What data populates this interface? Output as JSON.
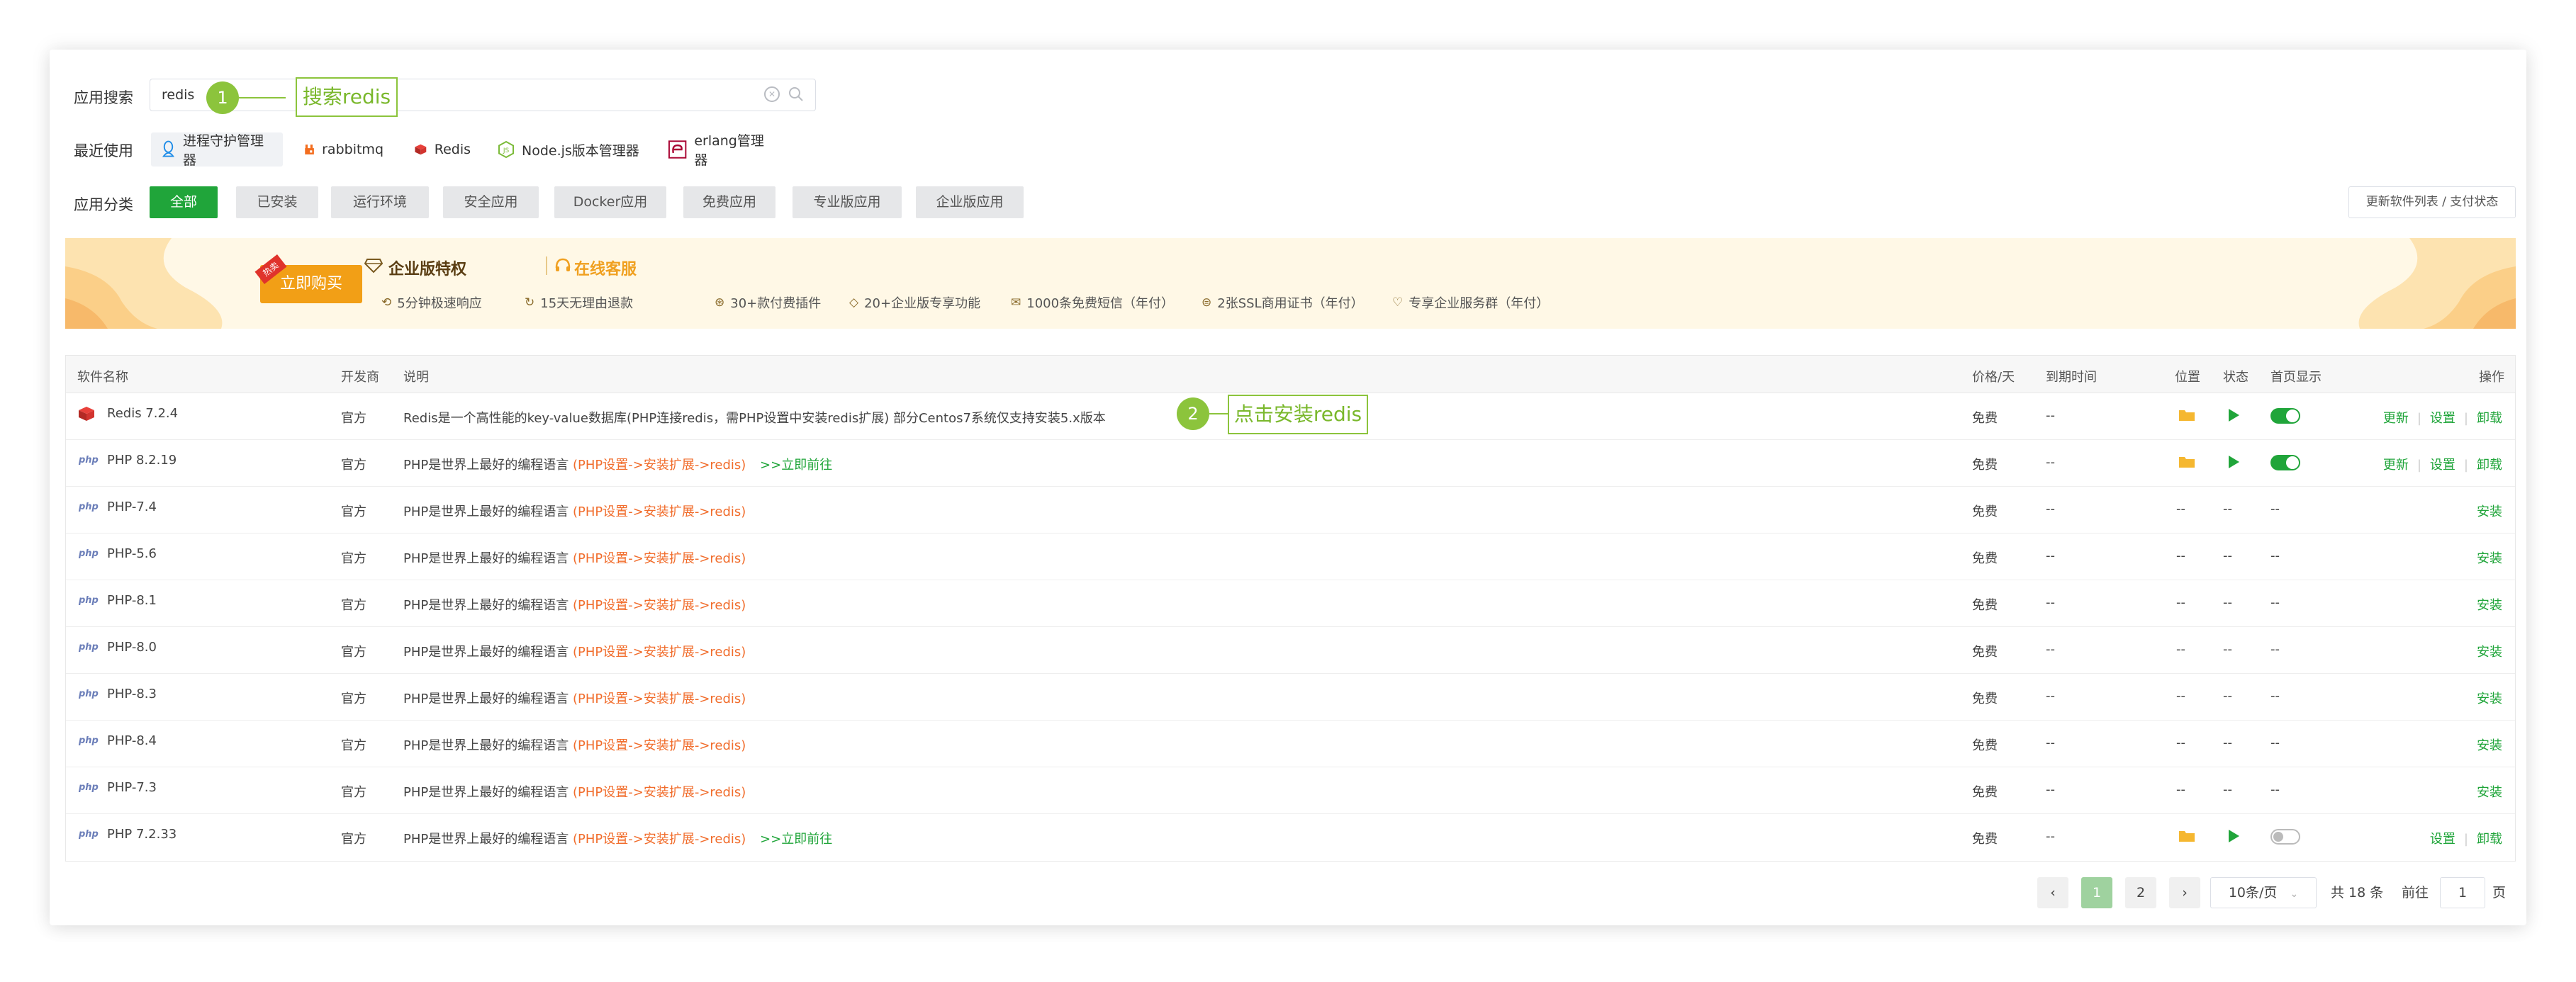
{
  "search": {
    "label": "应用搜索",
    "value": "redis",
    "callout": {
      "number": "1",
      "text": "搜索redis"
    }
  },
  "recent": {
    "label": "最近使用",
    "items": [
      {
        "label": "进程守护管理器",
        "icon": "penguin-icon"
      },
      {
        "label": "rabbitmq",
        "icon": "rabbitmq-icon"
      },
      {
        "label": "Redis",
        "icon": "redis-icon"
      },
      {
        "label": "Node.js版本管理器",
        "icon": "nodejs-icon"
      },
      {
        "label": "erlang管理器",
        "icon": "erlang-icon"
      }
    ]
  },
  "categories": {
    "label": "应用分类",
    "tabs": [
      "全部",
      "已安装",
      "运行环境",
      "安全应用",
      "Docker应用",
      "免费应用",
      "专业版应用",
      "企业版应用"
    ],
    "active": 0,
    "update_button": "更新软件列表 / 支付状态"
  },
  "banner": {
    "hot_tag": "热卖",
    "buy_button": "立即购买",
    "title": "企业版特权",
    "service": "在线客服",
    "features": [
      "5分钟极速响应",
      "15天无理由退款",
      "30+款付费插件",
      "20+企业版专享功能",
      "1000条免费短信（年付）",
      "2张SSL商用证书（年付）",
      "专享企业服务群（年付）"
    ]
  },
  "table": {
    "headers": [
      "软件名称",
      "开发商",
      "说明",
      "价格/天",
      "到期时间",
      "位置",
      "状态",
      "首页显示",
      "操作"
    ],
    "callout": {
      "number": "2",
      "text": "点击安装redis"
    },
    "rows": [
      {
        "name": "Redis 7.2.4",
        "icon": "redis",
        "vendor": "官方",
        "desc": "Redis是一个高性能的key-value数据库(PHP连接redis，需PHP设置中安装redis扩展) 部分Centos7系统仅支持安装5.x版本",
        "hint": "",
        "link": "",
        "price": "免费",
        "expire": "--",
        "installed": true,
        "home_on": true,
        "actions": [
          "更新",
          "设置",
          "卸载"
        ]
      },
      {
        "name": "PHP 8.2.19",
        "icon": "php",
        "vendor": "官方",
        "desc": "PHP是世界上最好的编程语言",
        "hint": "(PHP设置->安装扩展->redis)",
        "link": ">>立即前往",
        "price": "免费",
        "expire": "--",
        "installed": true,
        "home_on": true,
        "actions": [
          "更新",
          "设置",
          "卸载"
        ]
      },
      {
        "name": "PHP-7.4",
        "icon": "php",
        "vendor": "官方",
        "desc": "PHP是世界上最好的编程语言",
        "hint": "(PHP设置->安装扩展->redis)",
        "link": "",
        "price": "免费",
        "expire": "--",
        "installed": false,
        "actions": [
          "安装"
        ]
      },
      {
        "name": "PHP-5.6",
        "icon": "php",
        "vendor": "官方",
        "desc": "PHP是世界上最好的编程语言",
        "hint": "(PHP设置->安装扩展->redis)",
        "link": "",
        "price": "免费",
        "expire": "--",
        "installed": false,
        "actions": [
          "安装"
        ]
      },
      {
        "name": "PHP-8.1",
        "icon": "php",
        "vendor": "官方",
        "desc": "PHP是世界上最好的编程语言",
        "hint": "(PHP设置->安装扩展->redis)",
        "link": "",
        "price": "免费",
        "expire": "--",
        "installed": false,
        "actions": [
          "安装"
        ]
      },
      {
        "name": "PHP-8.0",
        "icon": "php",
        "vendor": "官方",
        "desc": "PHP是世界上最好的编程语言",
        "hint": "(PHP设置->安装扩展->redis)",
        "link": "",
        "price": "免费",
        "expire": "--",
        "installed": false,
        "actions": [
          "安装"
        ]
      },
      {
        "name": "PHP-8.3",
        "icon": "php",
        "vendor": "官方",
        "desc": "PHP是世界上最好的编程语言",
        "hint": "(PHP设置->安装扩展->redis)",
        "link": "",
        "price": "免费",
        "expire": "--",
        "installed": false,
        "actions": [
          "安装"
        ]
      },
      {
        "name": "PHP-8.4",
        "icon": "php",
        "vendor": "官方",
        "desc": "PHP是世界上最好的编程语言",
        "hint": "(PHP设置->安装扩展->redis)",
        "link": "",
        "price": "免费",
        "expire": "--",
        "installed": false,
        "actions": [
          "安装"
        ]
      },
      {
        "name": "PHP-7.3",
        "icon": "php",
        "vendor": "官方",
        "desc": "PHP是世界上最好的编程语言",
        "hint": "(PHP设置->安装扩展->redis)",
        "link": "",
        "price": "免费",
        "expire": "--",
        "installed": false,
        "actions": [
          "安装"
        ]
      },
      {
        "name": "PHP 7.2.33",
        "icon": "php",
        "vendor": "官方",
        "desc": "PHP是世界上最好的编程语言",
        "hint": "(PHP设置->安装扩展->redis)",
        "link": ">>立即前往",
        "price": "免费",
        "expire": "--",
        "installed": true,
        "home_on": false,
        "actions": [
          "设置",
          "卸载"
        ]
      }
    ],
    "empty": "--"
  },
  "pagination": {
    "prev": "‹",
    "pages": [
      "1",
      "2"
    ],
    "current": "1",
    "next": "›",
    "page_size": "10条/页",
    "total": "共 18 条",
    "goto_label": "前往",
    "goto_value": "1",
    "goto_unit": "页"
  },
  "colors": {
    "primary": "#20a53a",
    "orange": "#f16d2c",
    "callout": "#8cc43c",
    "buy": "#f29f16"
  }
}
